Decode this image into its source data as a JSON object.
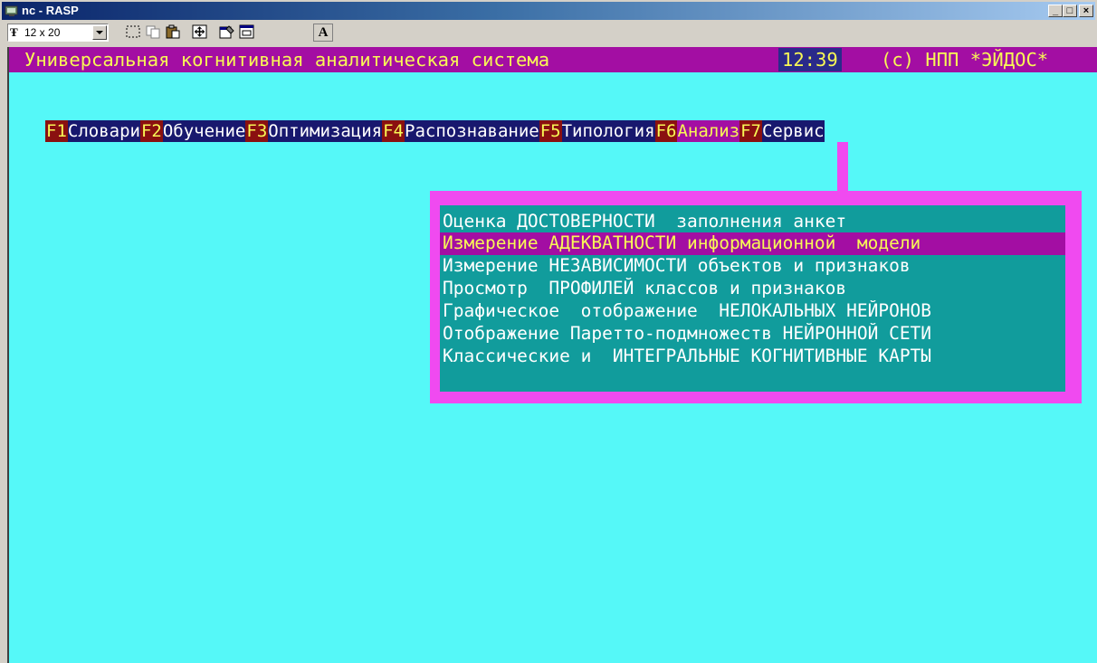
{
  "window": {
    "title": "nc - RASP",
    "controls": {
      "minimize": "_",
      "maximize": "□",
      "close": "×"
    }
  },
  "toolbar": {
    "font_size_value": "12 x 20",
    "font_icon_glyph": "Ŧ",
    "font_button_label": "A",
    "buttons": [
      "select-icon",
      "copy-icon",
      "paste-icon",
      "fullscreen-icon",
      "properties-icon",
      "background-icon",
      "font-icon"
    ]
  },
  "status": {
    "title": "Универсальная когнитивная аналитическая система",
    "time": "12:39",
    "copyright": "(с) НПП *ЭЙДОС*"
  },
  "menu": [
    {
      "key": "F1",
      "label": "Словари",
      "active": false
    },
    {
      "key": "F2",
      "label": "Обучение",
      "active": false
    },
    {
      "key": "F3",
      "label": "Оптимизация",
      "active": false
    },
    {
      "key": "F4",
      "label": "Распознавание",
      "active": false
    },
    {
      "key": "F5",
      "label": "Типология",
      "active": false
    },
    {
      "key": "F6",
      "label": "Анализ",
      "active": true
    },
    {
      "key": "F7",
      "label": "Сервис",
      "active": false
    }
  ],
  "submenu": {
    "items": [
      "Оценка ДОСТОВЕРНОСТИ  заполнения анкет",
      "Измерение АДЕКВАТНОСТИ информационной  модели",
      "Измерение НЕЗАВИСИМОСТИ объектов и признаков",
      "Просмотр  ПРОФИЛЕЙ классов и признаков",
      "Графическое  отображение  НЕЛОКАЛЬНЫХ НЕЙРОНОВ",
      "Отображение Паретто-подмножеств НЕЙРОННОЙ СЕТИ",
      "Классические и  ИНТЕГРАЛЬНЫЕ КОГНИТИВНЫЕ КАРТЫ"
    ],
    "selected_index": 1
  },
  "colors": {
    "console_bg": "#55f8f8",
    "status_bg": "#a30ea3",
    "menu_bg": "#18186e",
    "fkey_bg": "#8a1010",
    "highlight_text": "#f8f855",
    "dropdown_frame": "#f04af0",
    "dropdown_bg": "#119c9c"
  }
}
